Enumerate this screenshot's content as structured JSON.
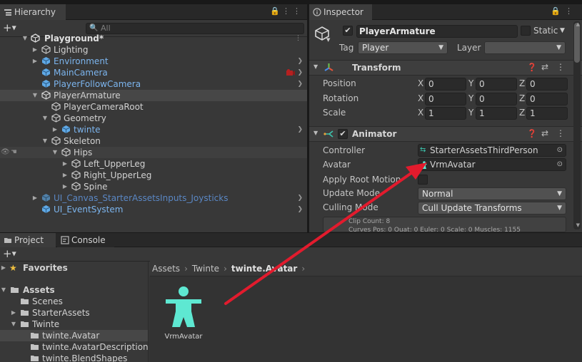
{
  "hierarchy": {
    "tab_label": "Hierarchy",
    "search_placeholder": "All",
    "scene_name": "Playground*",
    "items": [
      {
        "label": "Lighting"
      },
      {
        "label": "Environment"
      },
      {
        "label": "MainCamera"
      },
      {
        "label": "PlayerFollowCamera"
      },
      {
        "label": "PlayerArmature"
      },
      {
        "label": "PlayerCameraRoot"
      },
      {
        "label": "Geometry"
      },
      {
        "label": "twinte"
      },
      {
        "label": "Skeleton"
      },
      {
        "label": "Hips"
      },
      {
        "label": "Left_UpperLeg"
      },
      {
        "label": "Right_UpperLeg"
      },
      {
        "label": "Spine"
      },
      {
        "label": "UI_Canvas_StarterAssetsInputs_Joysticks"
      },
      {
        "label": "UI_EventSystem"
      }
    ]
  },
  "inspector": {
    "tab_label": "Inspector",
    "object_name": "PlayerArmature",
    "static_label": "Static",
    "tag_label": "Tag",
    "tag_value": "Player",
    "layer_label": "Layer",
    "layer_value": "",
    "transform": {
      "title": "Transform",
      "position_label": "Position",
      "rotation_label": "Rotation",
      "scale_label": "Scale",
      "position": {
        "x": "0",
        "y": "0",
        "z": "0"
      },
      "rotation": {
        "x": "0",
        "y": "0",
        "z": "0"
      },
      "scale": {
        "x": "1",
        "y": "1",
        "z": "1"
      }
    },
    "animator": {
      "title": "Animator",
      "controller_label": "Controller",
      "controller_value": "StarterAssetsThirdPerson",
      "avatar_label": "Avatar",
      "avatar_value": "VrmAvatar",
      "apply_root_motion_label": "Apply Root Motion",
      "update_mode_label": "Update Mode",
      "update_mode_value": "Normal",
      "culling_mode_label": "Culling Mode",
      "culling_mode_value": "Cull Update Transforms",
      "info_line1": "Clip Count: 8",
      "info_line2": "Curves Pos: 0 Quat: 0 Euler: 0 Scale: 0 Muscles: 1155"
    },
    "axis_labels": {
      "x": "X",
      "y": "Y",
      "z": "Z"
    }
  },
  "project": {
    "tab_project": "Project",
    "tab_console": "Console",
    "favorites_label": "Favorites",
    "assets_label": "Assets",
    "folders": [
      {
        "label": "Scenes"
      },
      {
        "label": "StarterAssets"
      },
      {
        "label": "Twinte"
      },
      {
        "label": "twinte.Avatar"
      },
      {
        "label": "twinte.AvatarDescription"
      },
      {
        "label": "twinte.BlendShapes"
      }
    ],
    "breadcrumb": {
      "a": "Assets",
      "b": "Twinte",
      "c": "twinte.Avatar"
    },
    "asset_label": "VrmAvatar"
  },
  "colors": {
    "arrow_annotation": "#e21b2d",
    "avatar_icon": "#5ee8d2",
    "selection": "#474747",
    "link_text": "#7cb5ee"
  }
}
